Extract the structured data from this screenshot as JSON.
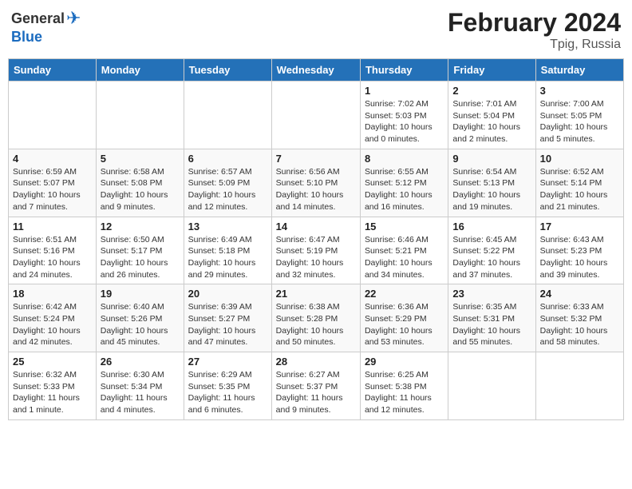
{
  "header": {
    "logo_general": "General",
    "logo_blue": "Blue",
    "month_title": "February 2024",
    "location": "Tpig, Russia"
  },
  "weekdays": [
    "Sunday",
    "Monday",
    "Tuesday",
    "Wednesday",
    "Thursday",
    "Friday",
    "Saturday"
  ],
  "weeks": [
    [
      {
        "day": "",
        "info": ""
      },
      {
        "day": "",
        "info": ""
      },
      {
        "day": "",
        "info": ""
      },
      {
        "day": "",
        "info": ""
      },
      {
        "day": "1",
        "info": "Sunrise: 7:02 AM\nSunset: 5:03 PM\nDaylight: 10 hours and 0 minutes."
      },
      {
        "day": "2",
        "info": "Sunrise: 7:01 AM\nSunset: 5:04 PM\nDaylight: 10 hours and 2 minutes."
      },
      {
        "day": "3",
        "info": "Sunrise: 7:00 AM\nSunset: 5:05 PM\nDaylight: 10 hours and 5 minutes."
      }
    ],
    [
      {
        "day": "4",
        "info": "Sunrise: 6:59 AM\nSunset: 5:07 PM\nDaylight: 10 hours and 7 minutes."
      },
      {
        "day": "5",
        "info": "Sunrise: 6:58 AM\nSunset: 5:08 PM\nDaylight: 10 hours and 9 minutes."
      },
      {
        "day": "6",
        "info": "Sunrise: 6:57 AM\nSunset: 5:09 PM\nDaylight: 10 hours and 12 minutes."
      },
      {
        "day": "7",
        "info": "Sunrise: 6:56 AM\nSunset: 5:10 PM\nDaylight: 10 hours and 14 minutes."
      },
      {
        "day": "8",
        "info": "Sunrise: 6:55 AM\nSunset: 5:12 PM\nDaylight: 10 hours and 16 minutes."
      },
      {
        "day": "9",
        "info": "Sunrise: 6:54 AM\nSunset: 5:13 PM\nDaylight: 10 hours and 19 minutes."
      },
      {
        "day": "10",
        "info": "Sunrise: 6:52 AM\nSunset: 5:14 PM\nDaylight: 10 hours and 21 minutes."
      }
    ],
    [
      {
        "day": "11",
        "info": "Sunrise: 6:51 AM\nSunset: 5:16 PM\nDaylight: 10 hours and 24 minutes."
      },
      {
        "day": "12",
        "info": "Sunrise: 6:50 AM\nSunset: 5:17 PM\nDaylight: 10 hours and 26 minutes."
      },
      {
        "day": "13",
        "info": "Sunrise: 6:49 AM\nSunset: 5:18 PM\nDaylight: 10 hours and 29 minutes."
      },
      {
        "day": "14",
        "info": "Sunrise: 6:47 AM\nSunset: 5:19 PM\nDaylight: 10 hours and 32 minutes."
      },
      {
        "day": "15",
        "info": "Sunrise: 6:46 AM\nSunset: 5:21 PM\nDaylight: 10 hours and 34 minutes."
      },
      {
        "day": "16",
        "info": "Sunrise: 6:45 AM\nSunset: 5:22 PM\nDaylight: 10 hours and 37 minutes."
      },
      {
        "day": "17",
        "info": "Sunrise: 6:43 AM\nSunset: 5:23 PM\nDaylight: 10 hours and 39 minutes."
      }
    ],
    [
      {
        "day": "18",
        "info": "Sunrise: 6:42 AM\nSunset: 5:24 PM\nDaylight: 10 hours and 42 minutes."
      },
      {
        "day": "19",
        "info": "Sunrise: 6:40 AM\nSunset: 5:26 PM\nDaylight: 10 hours and 45 minutes."
      },
      {
        "day": "20",
        "info": "Sunrise: 6:39 AM\nSunset: 5:27 PM\nDaylight: 10 hours and 47 minutes."
      },
      {
        "day": "21",
        "info": "Sunrise: 6:38 AM\nSunset: 5:28 PM\nDaylight: 10 hours and 50 minutes."
      },
      {
        "day": "22",
        "info": "Sunrise: 6:36 AM\nSunset: 5:29 PM\nDaylight: 10 hours and 53 minutes."
      },
      {
        "day": "23",
        "info": "Sunrise: 6:35 AM\nSunset: 5:31 PM\nDaylight: 10 hours and 55 minutes."
      },
      {
        "day": "24",
        "info": "Sunrise: 6:33 AM\nSunset: 5:32 PM\nDaylight: 10 hours and 58 minutes."
      }
    ],
    [
      {
        "day": "25",
        "info": "Sunrise: 6:32 AM\nSunset: 5:33 PM\nDaylight: 11 hours and 1 minute."
      },
      {
        "day": "26",
        "info": "Sunrise: 6:30 AM\nSunset: 5:34 PM\nDaylight: 11 hours and 4 minutes."
      },
      {
        "day": "27",
        "info": "Sunrise: 6:29 AM\nSunset: 5:35 PM\nDaylight: 11 hours and 6 minutes."
      },
      {
        "day": "28",
        "info": "Sunrise: 6:27 AM\nSunset: 5:37 PM\nDaylight: 11 hours and 9 minutes."
      },
      {
        "day": "29",
        "info": "Sunrise: 6:25 AM\nSunset: 5:38 PM\nDaylight: 11 hours and 12 minutes."
      },
      {
        "day": "",
        "info": ""
      },
      {
        "day": "",
        "info": ""
      }
    ]
  ]
}
